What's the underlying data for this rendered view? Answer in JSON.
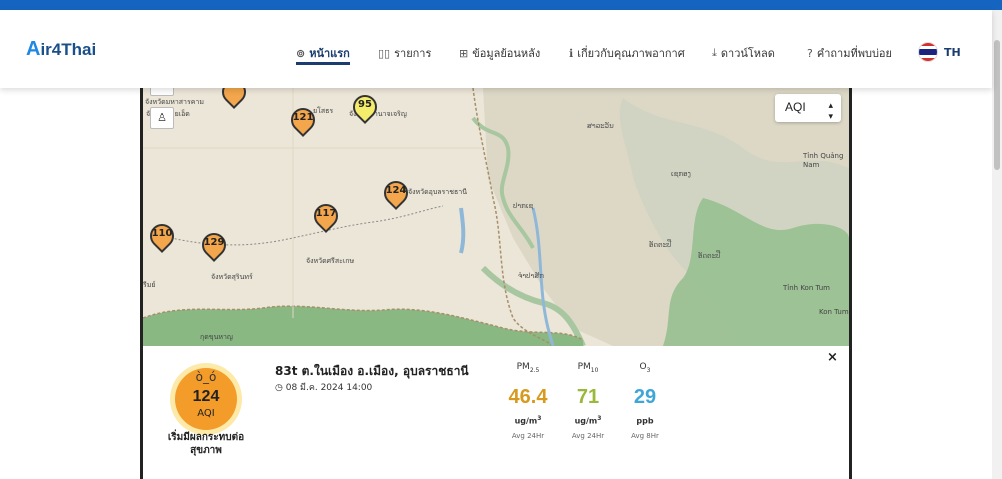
{
  "header": {
    "logo_mark": "A",
    "logo_text": "ir4Thai",
    "nav": [
      {
        "label": "หน้าแรก",
        "icon": "map-marker-icon",
        "glyph": "⊚"
      },
      {
        "label": "รายการ",
        "icon": "list-icon",
        "glyph": "▯▯"
      },
      {
        "label": "ข้อมูลย้อนหลัง",
        "icon": "table-icon",
        "glyph": "⊞"
      },
      {
        "label": "เกี่ยวกับคุณภาพอากาศ",
        "icon": "info-icon",
        "glyph": "ℹ"
      },
      {
        "label": "ดาวน์โหลด",
        "icon": "download-icon",
        "glyph": "⤓"
      },
      {
        "label": "คำถามที่พบบ่อย",
        "icon": "question-icon",
        "glyph": "?"
      }
    ],
    "language": "TH"
  },
  "map": {
    "select_value": "AQI",
    "markers": [
      {
        "value": "95",
        "color": "#f5ec6b"
      },
      {
        "value": "121",
        "color": "#f3a64b"
      },
      {
        "value": "124",
        "color": "#f3a64b"
      },
      {
        "value": "117",
        "color": "#f3a64b"
      },
      {
        "value": "110",
        "color": "#f3a64b"
      },
      {
        "value": "129",
        "color": "#f3a64b"
      }
    ],
    "labels": {
      "mahasarakham": "จังหวัดมหาสารคาม",
      "roiet": "จังหวัดร้อยเอ็ด",
      "yasothon": "ยโสธร",
      "amnatcharoen": "จังหวัดอำนาจเจริญ",
      "ubon": "จังหวัดอุบลราชธานี",
      "sisaket": "จังหวัดศรีสะเกษ",
      "surin": "จังหวัดสุรินทร์",
      "buriram": "รีมย์",
      "salavan": "ສາລະວັນ",
      "xekong": "ເຊກອງ",
      "pakse": "ປາກເຊ",
      "attapeu": "ອັດຕະປື",
      "champasak": "ຈຳປາສັກ",
      "attapeu2": "ອັດຕະປື",
      "quangnam": "Tỉnh Quảng Nam",
      "kontum_prov": "Tỉnh Kon Tum",
      "kontum": "Kon Tum",
      "kukhan": "กุดขุนหาญ"
    }
  },
  "station": {
    "name": "83t ต.ในเมือง อ.เมือง, อุบลราชธานี",
    "datetime": "08 มี.ค. 2024 14:00",
    "aqi_value": "124",
    "aqi_label": "AQI",
    "level_text": "เริ่มมีผลกระทบต่อสุขภาพ",
    "aqi_color": "#f39c2a"
  },
  "pollutants": [
    {
      "name": "PM",
      "sub": "2.5",
      "value": "46.4",
      "unit": "ug/m",
      "sup": "3",
      "avg": "Avg 24Hr",
      "color": "#d89a1e"
    },
    {
      "name": "PM",
      "sub": "10",
      "value": "71",
      "unit": "ug/m",
      "sup": "3",
      "avg": "Avg 24Hr",
      "color": "#9ab83a"
    },
    {
      "name": "O",
      "sub": "3",
      "value": "29",
      "unit": "ppb",
      "sup": "",
      "avg": "Avg 8Hr",
      "color": "#3fa6d8"
    }
  ]
}
